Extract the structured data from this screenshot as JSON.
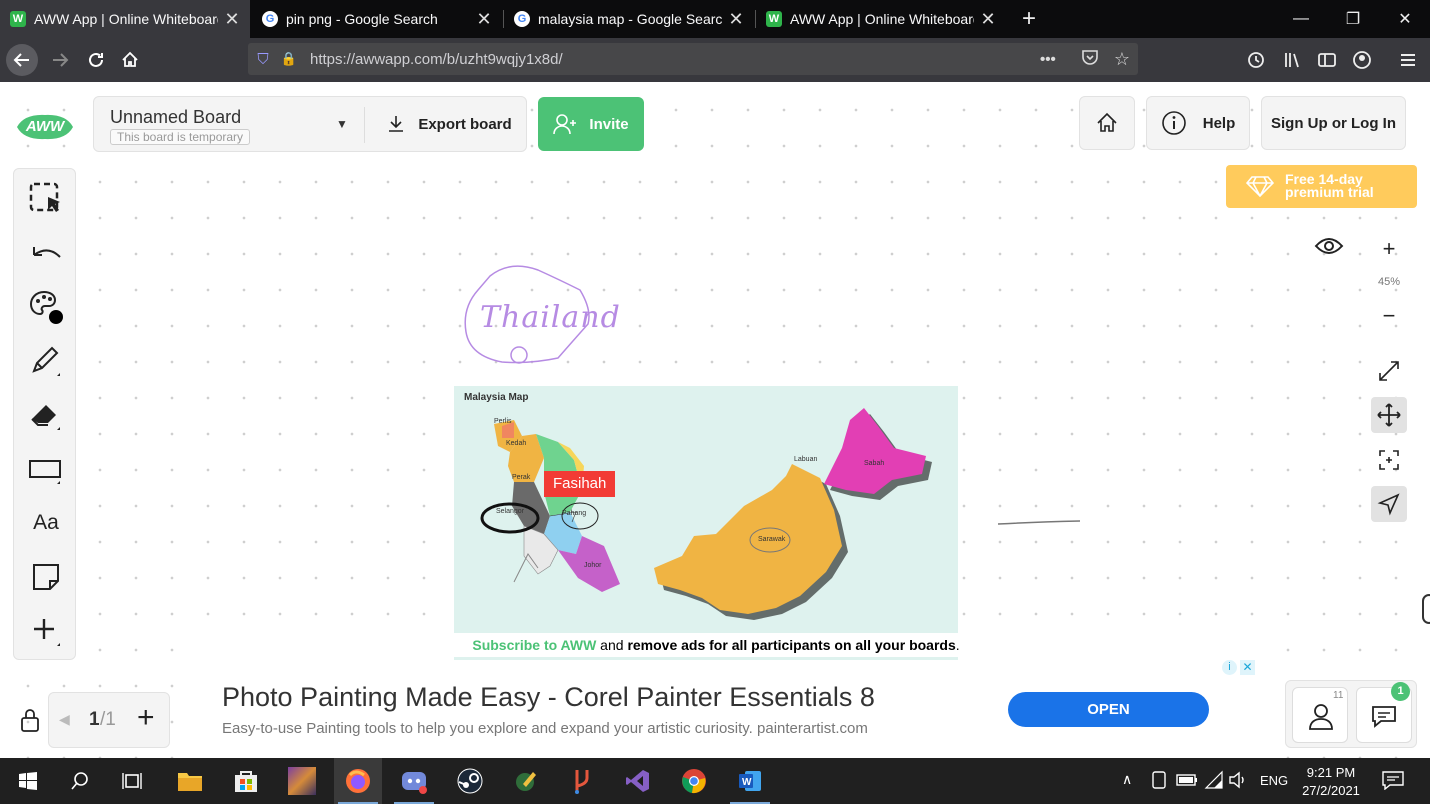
{
  "browser": {
    "tabs": [
      {
        "title": "AWW App | Online Whiteboard",
        "favicon": "W",
        "favicon_color": "#2fb44b",
        "active": true
      },
      {
        "title": "pin png - Google Search",
        "favicon": "G",
        "favicon_color": "#4285f4",
        "active": false
      },
      {
        "title": "malaysia map - Google Search",
        "favicon": "G",
        "favicon_color": "#4285f4",
        "active": false
      },
      {
        "title": "AWW App | Online Whiteboard",
        "favicon": "W",
        "favicon_color": "#2fb44b",
        "active": false
      }
    ],
    "new_tab": "+",
    "url": "https://awwapp.com/b/uzht9wqjy1x8d/",
    "window_controls": {
      "minimize": "—",
      "restore": "❐",
      "close": "✕"
    }
  },
  "header": {
    "board_name": "Unnamed Board",
    "board_sub": "This board is temporary",
    "export_label": "Export board",
    "invite_label": "Invite",
    "help_label": "Help",
    "signup_label": "Sign Up or Log In",
    "trial_line1": "Free 14-day",
    "trial_line2": "premium trial",
    "logo_text": "AWW"
  },
  "zoom": {
    "level": "45%",
    "plus": "+",
    "minus": "−"
  },
  "canvas": {
    "thailand_text": "Thailand",
    "map_title": "Malaysia Map",
    "cursor_label": "Fasihah",
    "labels": {
      "selangor": "Selangor",
      "pahang": "Pahang",
      "johor": "Johor",
      "sabah": "Sabah",
      "sarawak": "Sarawak",
      "labuan": "Labuan",
      "kedah": "Kedah",
      "perak": "Perak",
      "perlis": "Perlis"
    }
  },
  "subscribe": {
    "link": "Subscribe to AWW",
    "middle": " and ",
    "bold": "remove ads for all participants on all your boards",
    "end": "."
  },
  "ad": {
    "title": "Photo Painting Made Easy - Corel Painter Essentials 8",
    "desc": "Easy-to-use Painting tools to help you explore and expand your artistic curiosity. painterartist.com",
    "open_label": "OPEN"
  },
  "pages": {
    "current": "1",
    "total": "/1"
  },
  "users": {
    "count": "11",
    "chat_count": "1"
  },
  "taskbar": {
    "time": "9:21 PM",
    "date": "27/2/2021",
    "lang": "ENG"
  },
  "colors": {
    "green": "#4cc276",
    "trial": "#ffcb5c",
    "sabah": "#e23fb4",
    "map_orange": "#f0b443",
    "map_bg": "#def2ee",
    "cursor": "#f23b35"
  }
}
